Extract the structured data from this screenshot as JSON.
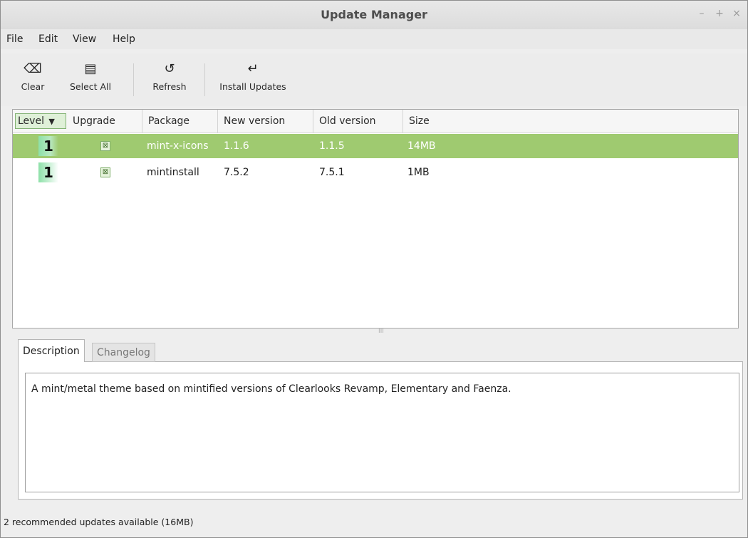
{
  "window": {
    "title": "Update Manager"
  },
  "window_controls": {
    "minimize": "–",
    "maximize": "+",
    "close": "×"
  },
  "menubar": {
    "items": [
      "File",
      "Edit",
      "View",
      "Help"
    ]
  },
  "toolbar": {
    "clear": {
      "label": "Clear",
      "icon": "backspace-icon",
      "glyph": "⌫"
    },
    "select_all": {
      "label": "Select All",
      "icon": "select-all-icon",
      "glyph": "▤"
    },
    "refresh": {
      "label": "Refresh",
      "icon": "refresh-icon",
      "glyph": "↺"
    },
    "install_updates": {
      "label": "Install Updates",
      "icon": "install-icon",
      "glyph": "↵"
    }
  },
  "list": {
    "columns": [
      "Level",
      "Upgrade",
      "Package",
      "New version",
      "Old version",
      "Size"
    ],
    "sort_indicator": "▼",
    "rows": [
      {
        "level": "1",
        "upgrade": "⊠",
        "package": "mint-x-icons",
        "new_version": "1.1.6",
        "old_version": "1.1.5",
        "size": "14MB"
      },
      {
        "level": "1",
        "upgrade": "⊠",
        "package": "mintinstall",
        "new_version": "7.5.2",
        "old_version": "7.5.1",
        "size": "1MB"
      }
    ]
  },
  "splitter": {
    "grip": "III"
  },
  "tabs": {
    "description": "Description",
    "changelog": "Changelog"
  },
  "description_text": "A mint/metal theme based on mintified versions of Clearlooks Revamp, Elementary and Faenza.",
  "status": "2 recommended updates available (16MB)",
  "colors": {
    "selection": "#9fca70",
    "level_badge": "#8de0a8"
  }
}
